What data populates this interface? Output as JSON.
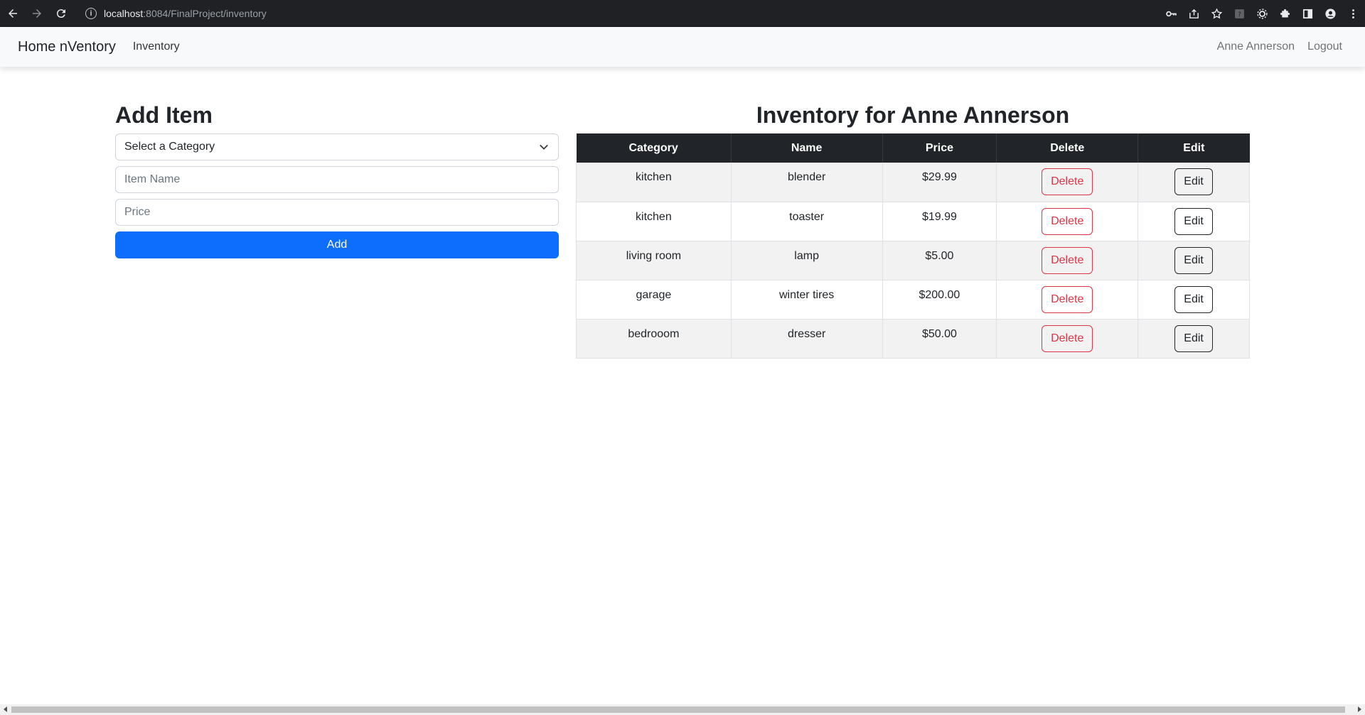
{
  "browser": {
    "url_host": "localhost",
    "url_rest": ":8084/FinalProject/inventory"
  },
  "navbar": {
    "brand": "Home nVentory",
    "links": [
      "Inventory"
    ],
    "user": "Anne Annerson",
    "logout": "Logout"
  },
  "form": {
    "title": "Add Item",
    "category_select": "Select a Category",
    "item_name_placeholder": "Item Name",
    "price_placeholder": "Price",
    "add_label": "Add"
  },
  "inventory": {
    "title": "Inventory for Anne Annerson",
    "headers": [
      "Category",
      "Name",
      "Price",
      "Delete",
      "Edit"
    ],
    "rows": [
      {
        "category": "kitchen",
        "name": "blender",
        "price": "$29.99",
        "delete": "Delete",
        "edit": "Edit"
      },
      {
        "category": "kitchen",
        "name": "toaster",
        "price": "$19.99",
        "delete": "Delete",
        "edit": "Edit"
      },
      {
        "category": "living room",
        "name": "lamp",
        "price": "$5.00",
        "delete": "Delete",
        "edit": "Edit"
      },
      {
        "category": "garage",
        "name": "winter tires",
        "price": "$200.00",
        "delete": "Delete",
        "edit": "Edit"
      },
      {
        "category": "bedrooom",
        "name": "dresser",
        "price": "$50.00",
        "delete": "Delete",
        "edit": "Edit"
      }
    ]
  },
  "colors": {
    "primary": "#0d6efd",
    "danger": "#dc3545",
    "table_header": "#212529",
    "navbar_bg": "#f8f9fa"
  },
  "icons": {
    "browser": [
      "back-arrow-icon",
      "forward-arrow-icon",
      "reload-icon",
      "site-info-icon"
    ],
    "toolbar": [
      "key-icon",
      "share-icon",
      "star-icon",
      "extension-help-icon",
      "extension-gear-icon",
      "puzzle-icon",
      "side-panel-icon",
      "profile-icon",
      "kebab-menu-icon"
    ]
  }
}
